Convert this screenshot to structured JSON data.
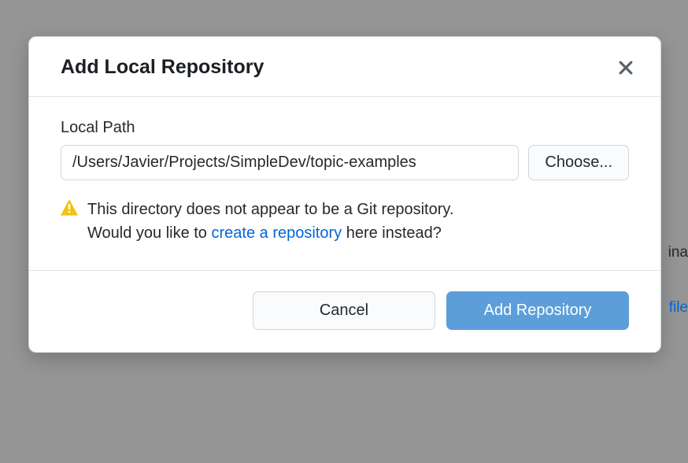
{
  "dialog": {
    "title": "Add Local Repository",
    "local_path_label": "Local Path",
    "local_path_value": "/Users/Javier/Projects/SimpleDev/topic-examples",
    "choose_label": "Choose...",
    "warning_line1": "This directory does not appear to be a Git repository.",
    "warning_line2_prefix": "Would you like to ",
    "warning_link": "create a repository",
    "warning_line2_suffix": " here instead?",
    "cancel_label": "Cancel",
    "submit_label": "Add Repository"
  },
  "backdrop": {
    "text_fragment_1": "ina",
    "link_fragment": "file"
  }
}
